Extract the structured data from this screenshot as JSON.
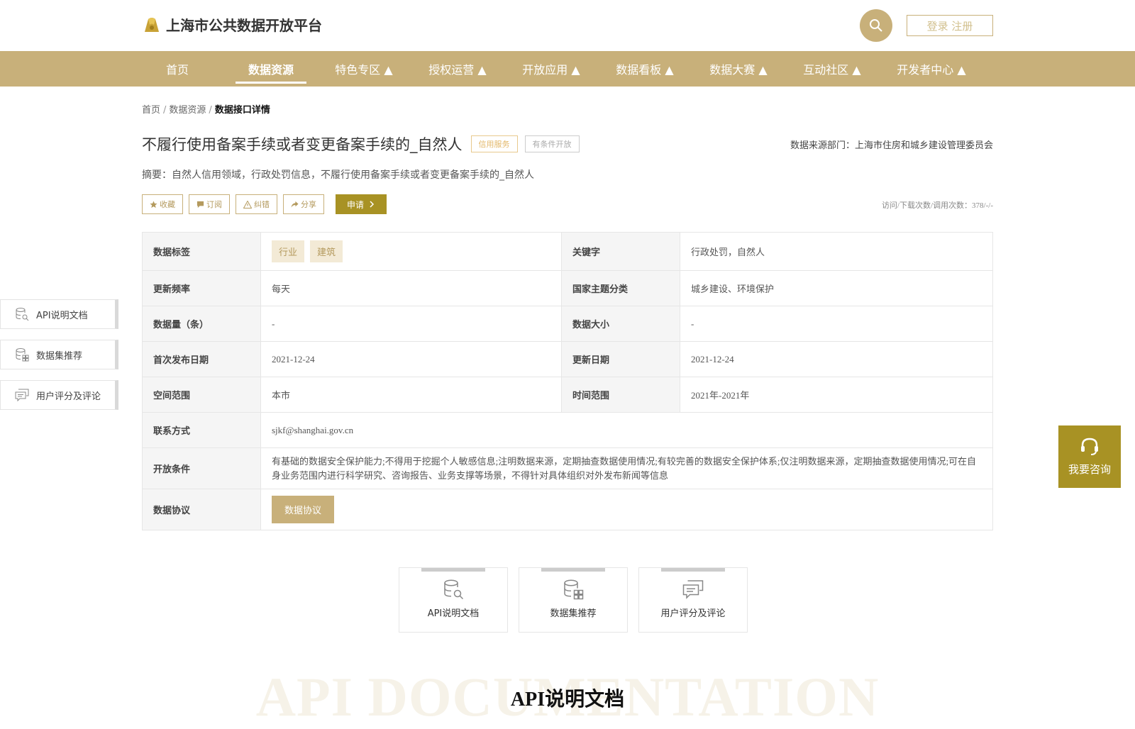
{
  "header": {
    "site_title": "上海市公共数据开放平台",
    "login_label": "登录 注册"
  },
  "nav": {
    "items": [
      {
        "label": "首页"
      },
      {
        "label": "数据资源"
      },
      {
        "label": "特色专区 ▲"
      },
      {
        "label": "授权运营 ▲"
      },
      {
        "label": "开放应用 ▲"
      },
      {
        "label": "数据看板 ▲"
      },
      {
        "label": "数据大赛 ▲"
      },
      {
        "label": "互动社区 ▲"
      },
      {
        "label": "开发者中心 ▲"
      }
    ],
    "active_index": 1
  },
  "breadcrumb": {
    "home": "首页",
    "sep1": "/",
    "resources": "数据资源",
    "sep2": "/",
    "current": "数据接口详情"
  },
  "dataset": {
    "title": "不履行使用备案手续或者变更备案手续的_自然人",
    "tag_service": "信用服务",
    "tag_open": "有条件开放",
    "source": "数据来源部门：上海市住房和城乡建设管理委员会",
    "summary": "摘要：自然人信用领域，行政处罚信息，不履行使用备案手续或者变更备案手续的_自然人"
  },
  "actions": {
    "collect": "收藏",
    "subscribe": "订阅",
    "correct": "纠错",
    "share": "分享",
    "apply": "申请"
  },
  "stats": "访问/下载次数/调用次数：378/-/-",
  "info": {
    "tags_label": "数据标签",
    "tags": [
      "行业",
      "建筑"
    ],
    "keyword_label": "关键字",
    "keyword": "行政处罚，自然人",
    "freq_label": "更新频率",
    "freq": "每天",
    "theme_label": "国家主题分类",
    "theme": "城乡建设、环境保护",
    "count_label": "数据量（条）",
    "count": "-",
    "size_label": "数据大小",
    "size": "-",
    "first_label": "首次发布日期",
    "first": "2021-12-24",
    "update_label": "更新日期",
    "update": "2021-12-24",
    "space_label": "空间范围",
    "space": "本市",
    "time_label": "时间范围",
    "time": "2021年-2021年",
    "contact_label": "联系方式",
    "contact": "sjkf@shanghai.gov.cn",
    "cond_label": "开放条件",
    "cond": "有基础的数据安全保护能力;不得用于挖掘个人敏感信息;注明数据来源，定期抽查数据使用情况;有较完善的数据安全保护体系;仅注明数据来源，定期抽查数据使用情况;可在自身业务范围内进行科学研究、咨询报告、业务支撑等场景，不得针对具体组织对外发布新闻等信息",
    "protocol_label": "数据协议",
    "protocol_btn": "数据协议"
  },
  "side_nav": [
    {
      "label": "API说明文档",
      "icon": "db-search-icon"
    },
    {
      "label": "数据集推荐",
      "icon": "db-grid-icon"
    },
    {
      "label": "用户评分及评论",
      "icon": "comment-icon"
    }
  ],
  "consult": "我要咨询",
  "cards": [
    {
      "label": "API说明文档",
      "icon": "db-search-icon"
    },
    {
      "label": "数据集推荐",
      "icon": "db-grid-icon"
    },
    {
      "label": "用户评分及评论",
      "icon": "comment-icon"
    }
  ],
  "section": {
    "watermark": "API DOCUMENTATION",
    "title": "API说明文档"
  },
  "colors": {
    "brand": "#c8b07a",
    "accent_dark": "#a89224"
  }
}
